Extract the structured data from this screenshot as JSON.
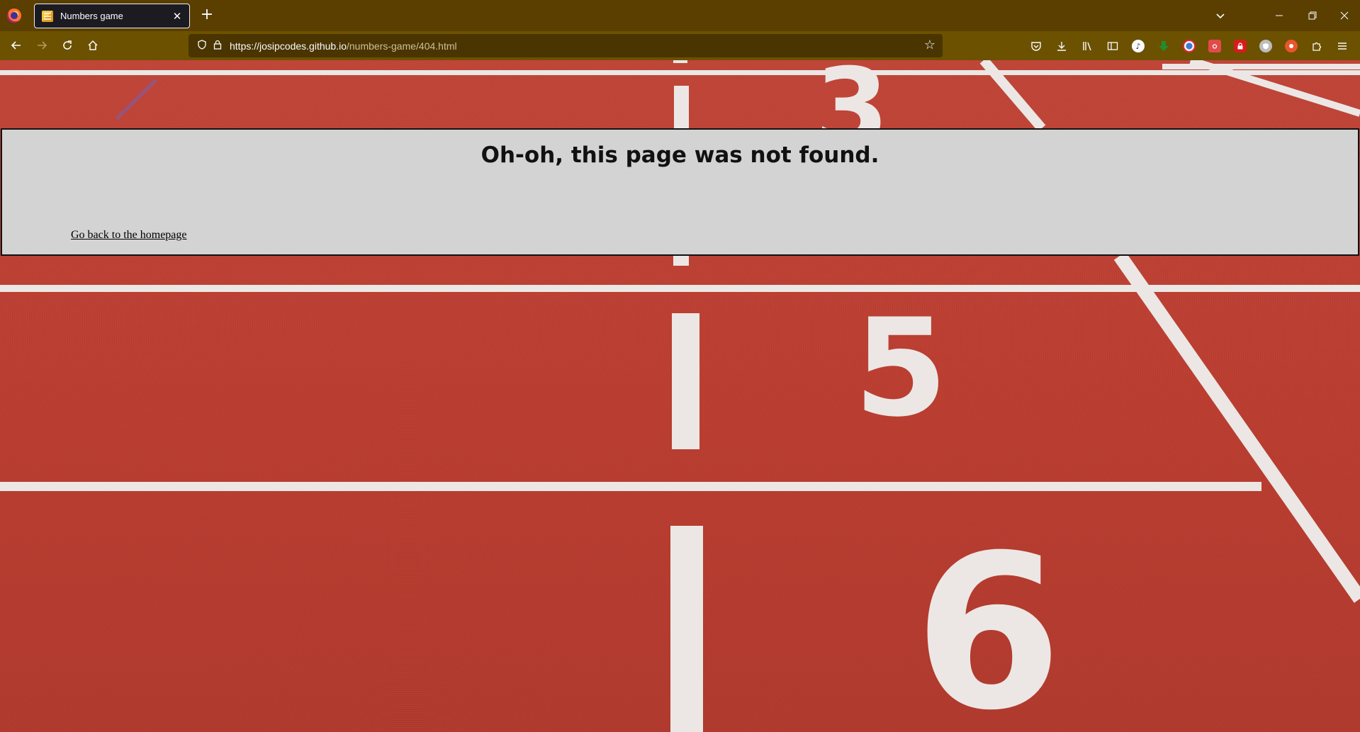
{
  "browser": {
    "tab": {
      "title": "Numbers game"
    },
    "url": {
      "host": "https://josipcodes.github.io",
      "path": "/numbers-game/404.html"
    }
  },
  "page": {
    "heading": "Oh-oh, this page was not found.",
    "home_link": "Go back to the homepage"
  },
  "track_numbers": [
    "3",
    "5",
    "6"
  ],
  "colors": {
    "tabbar": "#5a3f00",
    "navbar": "#6c5100",
    "track": "#c0453a",
    "box": "#d3d3d3"
  }
}
